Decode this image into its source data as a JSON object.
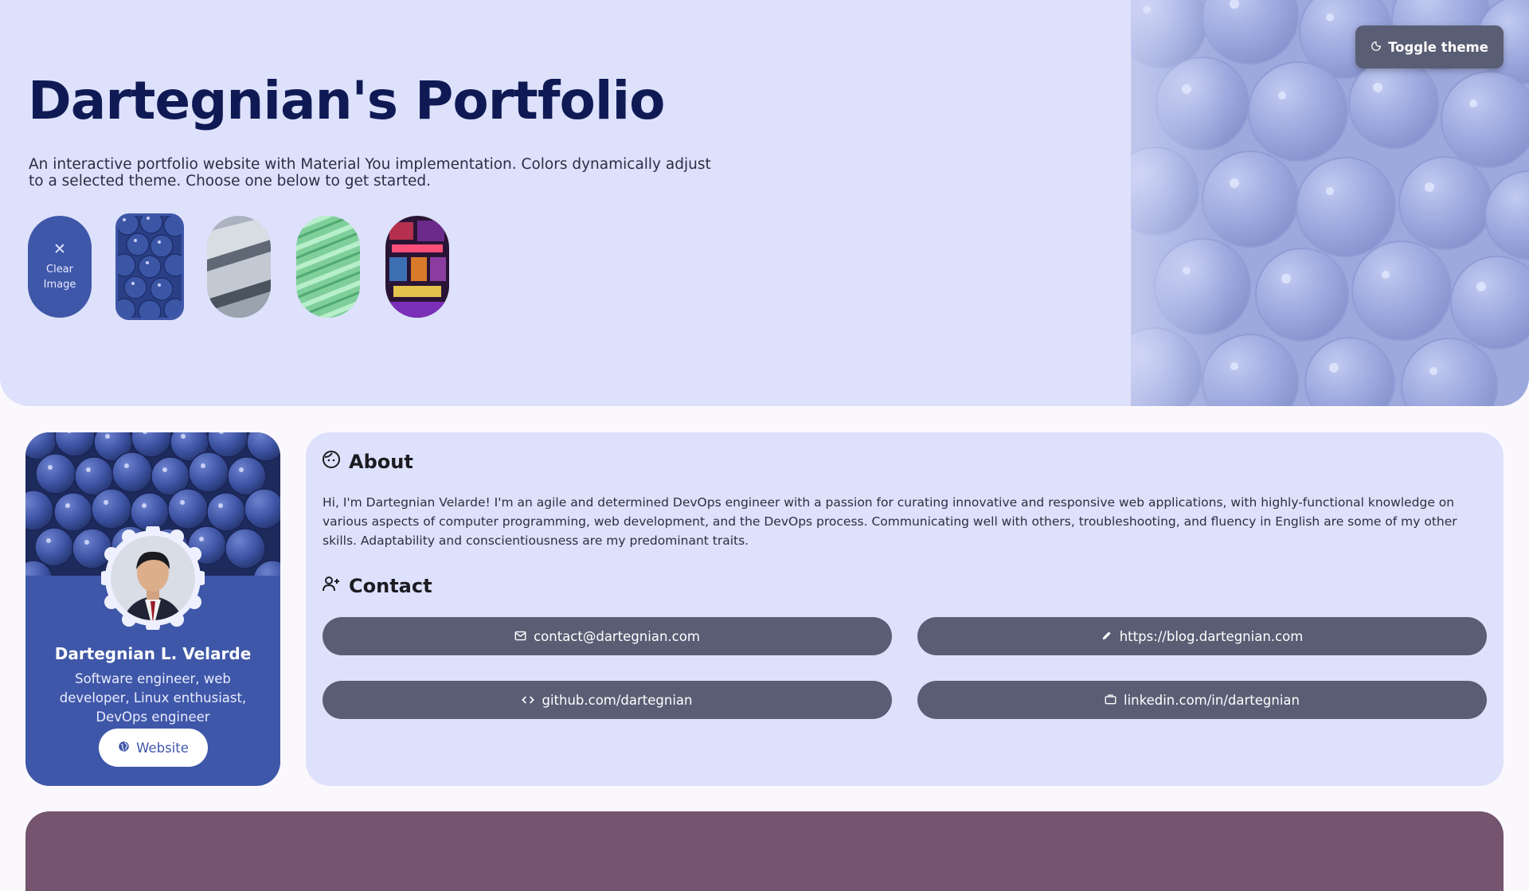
{
  "hero": {
    "title": "Dartegnian's Portfolio",
    "description": "An interactive portfolio website with Material You implementation. Colors dynamically adjust to a selected theme. Choose one below to get started.",
    "toggle_label": "Toggle theme",
    "toggle_icon": "moon-icon"
  },
  "themes": {
    "clear_label_1": "Clear",
    "clear_label_2": "Image",
    "clear_icon": "close-icon",
    "options": [
      "blueberries",
      "glass-blocks",
      "green-waves",
      "neon-arcade"
    ],
    "selected": "blueberries"
  },
  "profile": {
    "name": "Dartegnian L. Velarde",
    "role": "Software engineer, web developer, Linux enthusiast, DevOps engineer",
    "website_label": "Website",
    "website_icon": "globe-icon"
  },
  "about": {
    "heading": "About",
    "heading_icon": "face-icon",
    "text": "Hi, I'm Dartegnian Velarde! I'm an agile and determined DevOps engineer with a passion for curating innovative and responsive web applications, with highly-functional knowledge on various aspects of computer programming, web development, and the DevOps process. Communicating well with others, troubleshooting, and fluency in English are some of my other skills. Adaptability and conscientiousness are my predominant traits."
  },
  "contact": {
    "heading": "Contact",
    "heading_icon": "person-add-icon",
    "links": [
      {
        "label": "contact@dartegnian.com",
        "icon": "mail-icon"
      },
      {
        "label": "https://blog.dartegnian.com",
        "icon": "pencil-icon"
      },
      {
        "label": "github.com/dartegnian",
        "icon": "code-icon"
      },
      {
        "label": "linkedin.com/in/dartegnian",
        "icon": "briefcase-icon"
      }
    ]
  },
  "colors": {
    "hero_bg": "#dde1fb",
    "page_bg": "#fbf8fd",
    "primary": "#3f57a8",
    "title": "#0f1a55",
    "tonal_button": "#5a5e74",
    "tertiary_card": "#74546f"
  }
}
